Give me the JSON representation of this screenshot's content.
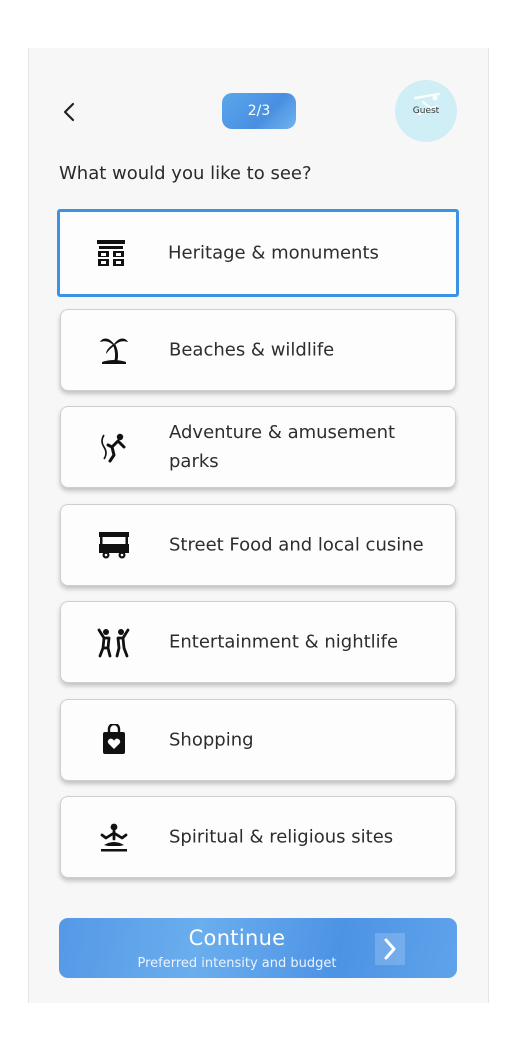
{
  "header": {
    "step": "2/3",
    "avatar_label": "Guest"
  },
  "prompt": "What would you like to see?",
  "options": [
    {
      "label": "Heritage & monuments",
      "icon": "monument-icon",
      "selected": true
    },
    {
      "label": "Beaches & wildlife",
      "icon": "palm-tree-icon",
      "selected": false
    },
    {
      "label": "Adventure & amusement parks",
      "icon": "bungee-jump-icon",
      "selected": false
    },
    {
      "label": "Street Food and local cusine",
      "icon": "food-cart-icon",
      "selected": false
    },
    {
      "label": "Entertainment & nightlife",
      "icon": "people-dancing-icon",
      "selected": false
    },
    {
      "label": "Shopping",
      "icon": "shopping-bag-heart-icon",
      "selected": false
    },
    {
      "label": "Spiritual & religious sites",
      "icon": "meditation-icon",
      "selected": false
    }
  ],
  "continue": {
    "title": "Continue",
    "subtitle": "Preferred intensity and budget"
  },
  "colors": {
    "accent": "#3d93e3",
    "button_gradient_start": "#5598e6",
    "avatar_bg": "#cfeef5"
  }
}
